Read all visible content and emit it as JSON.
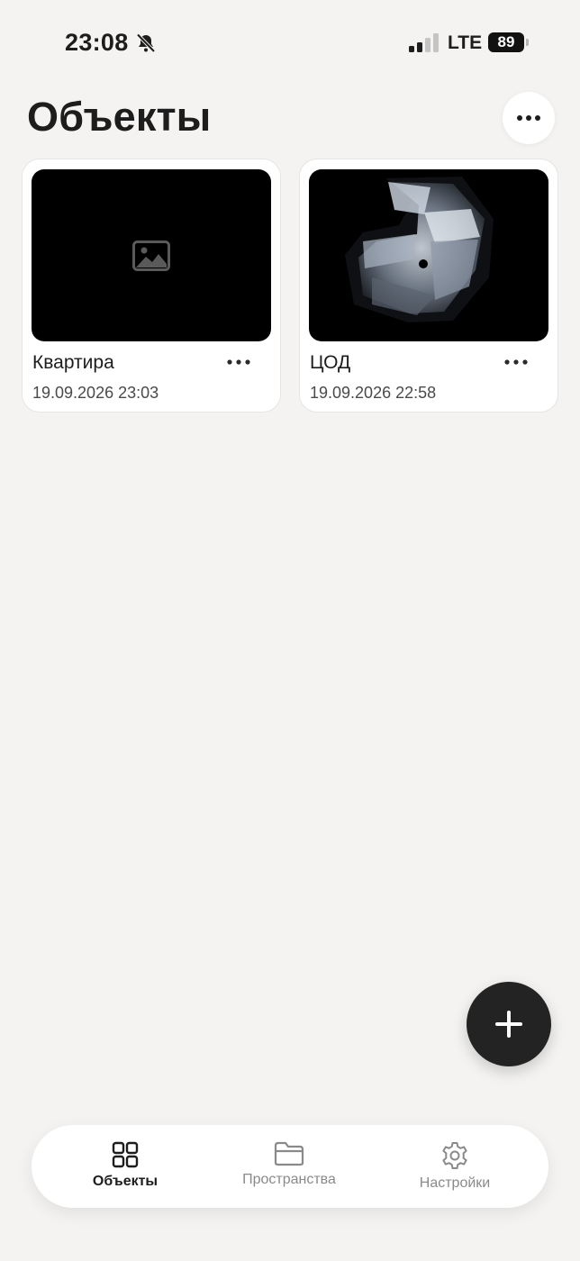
{
  "status_bar": {
    "time": "23:08",
    "network": "LTE",
    "battery": "89",
    "icons": [
      "bell-slash-icon",
      "signal-icon"
    ]
  },
  "header": {
    "title": "Объекты",
    "menu_icon": "more-horizontal-icon"
  },
  "cards": [
    {
      "title": "Квартира",
      "date": "19.09.2026 23:03",
      "thumbnail": "image-placeholder-icon"
    },
    {
      "title": "ЦОД",
      "date": "19.09.2026 22:58",
      "thumbnail": "point-cloud-preview"
    }
  ],
  "fab": {
    "icon": "plus-icon"
  },
  "bottom_nav": {
    "items": [
      {
        "label": "Объекты",
        "icon": "grid-icon",
        "active": true
      },
      {
        "label": "Пространства",
        "icon": "folder-icon",
        "active": false
      },
      {
        "label": "Настройки",
        "icon": "gear-icon",
        "active": false
      }
    ]
  },
  "colors": {
    "background": "#f4f3f1",
    "card": "#ffffff",
    "fab": "#232323",
    "text": "#1d1d1d",
    "muted": "#8a8a8a"
  }
}
